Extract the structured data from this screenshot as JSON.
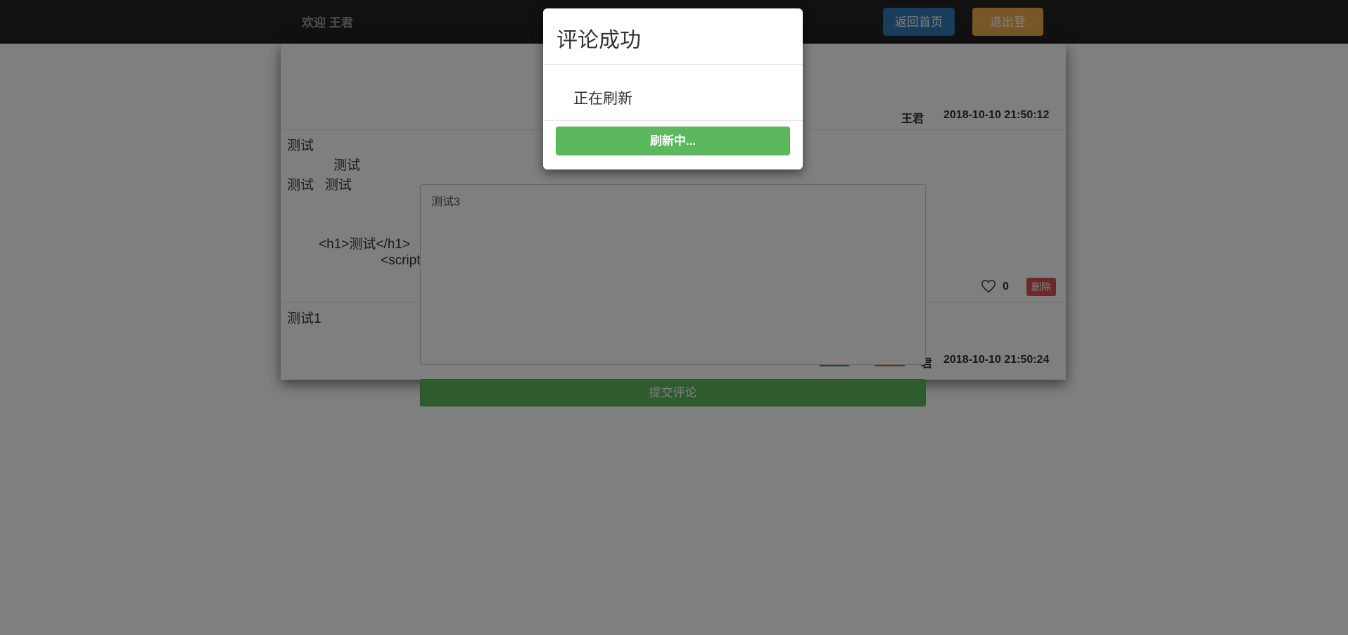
{
  "navbar": {
    "welcome": "欢迎 王君",
    "home_button": "返回首页",
    "logout_button": "退出登录"
  },
  "comments": [
    {
      "author": "王君",
      "time": "2018-10-10 21:50:12"
    },
    {
      "lines": [
        "测试",
        "测试",
        "测试   测试",
        "<h1>测试</h1>",
        "<script"
      ],
      "like_count": "0",
      "delete_label": "删除"
    },
    {
      "text": "测试1",
      "author_partial": "君",
      "time": "2018-10-10 21:50:24"
    }
  ],
  "composer": {
    "value": "测试3",
    "submit_label": "提交评论"
  },
  "modal": {
    "title": "评论成功",
    "message": "正在刷新",
    "button": "刷新中..."
  },
  "colors": {
    "navbar": "#222222",
    "primary": "#337ab7",
    "warning": "#f0ad4e",
    "success": "#5cb85c",
    "danger": "#d9534f"
  },
  "icons": {
    "like": "heart-outline-icon"
  }
}
